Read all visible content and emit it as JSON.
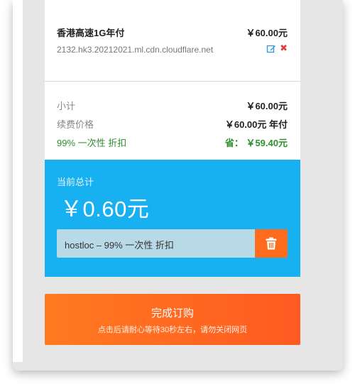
{
  "item": {
    "name": "香港高速1G年付",
    "price": "￥60.00元",
    "hostname": "2132.hk3.20212021.ml.cdn.cloudflare.net",
    "edit_icon": "edit-icon",
    "remove_icon": "close-icon",
    "remove_glyph": "✖"
  },
  "totals": {
    "subtotal_label": "小计",
    "subtotal_value": "￥60.00元",
    "renewal_label": "续费价格",
    "renewal_value": "￥60.00元 年付",
    "discount_label": "99% 一次性 折扣",
    "discount_value": "省： ￥59.40元"
  },
  "current_total": {
    "label": "当前总计",
    "amount": "￥0.60元"
  },
  "promo": {
    "text": "hostloc – 99% 一次性 折扣",
    "remove_icon": "trash-icon"
  },
  "checkout": {
    "label": "完成订购",
    "note": "点击后请耐心等待30秒左右，请勿关闭网页"
  },
  "colors": {
    "accent_blue": "#17b0f0",
    "accent_orange": "#ff6b1c",
    "discount_green": "#2f8f2f",
    "remove_red": "#e03c3c"
  }
}
